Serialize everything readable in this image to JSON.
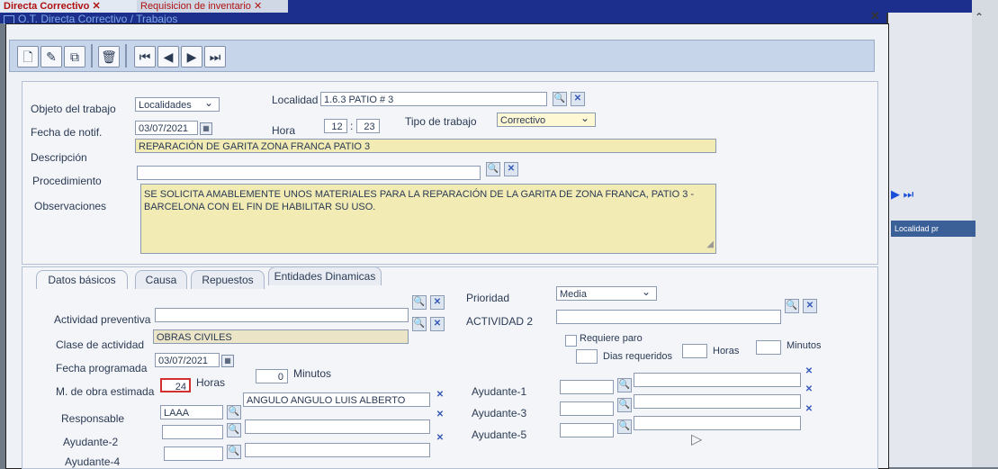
{
  "tabs": [
    {
      "label": "Directa Correctivo",
      "close": "✕"
    },
    {
      "label": "Requisicion de inventario",
      "close": "✕"
    }
  ],
  "breadcrumb": "O.T. Directa Correctivo / Trabajos",
  "toolbar": {
    "new": "🗋",
    "edit": "✎",
    "copy": "⧉",
    "delete": "🗑",
    "first": "⏮",
    "prev": "◀",
    "next": "▶",
    "last": "⏭"
  },
  "form": {
    "objeto_label": "Objeto del trabajo",
    "objeto_value": "Localidades",
    "localidad_label": "Localidad",
    "localidad_value": "1.6.3 PATIO # 3",
    "fecha_label": "Fecha de notif.",
    "fecha_value": "03/07/2021",
    "hora_label": "Hora",
    "hora_h": "12",
    "hora_sep": ":",
    "hora_m": "23",
    "tipo_label": "Tipo de trabajo",
    "tipo_value": "Correctivo",
    "descripcion_label": "Descripción",
    "descripcion_value": "REPARACIÓN DE GARITA ZONA FRANCA PATIO 3",
    "procedimiento_label": "Procedimiento",
    "procedimiento_value": "",
    "observaciones_label": "Observaciones",
    "observaciones_line1": "SE SOLICITA AMABLEMENTE UNOS MATERIALES PARA LA REPARACIÓN DE LA GARITA DE ZONA FRANCA, PATIO 3 -",
    "observaciones_line2": "BARCELONA CON EL FIN DE HABILITAR SU USO."
  },
  "panel_tabs": [
    "Datos básicos",
    "Causa",
    "Repuestos",
    "Entidades Dinamicas"
  ],
  "datos": {
    "actividad_prev_label": "Actividad preventiva",
    "clase_label": "Clase de actividad",
    "clase_value": "OBRAS CIVILES",
    "fecha_prog_label": "Fecha programada",
    "fecha_prog_value": "03/07/2021",
    "mano_obra_label": "M. de obra estimada",
    "mano_obra_horas": "24",
    "horas_label": "Horas",
    "minutos_value": "0",
    "minutos_label": "Minutos",
    "responsable_label": "Responsable",
    "responsable_code": "LAAA",
    "responsable_name": "ANGULO ANGULO LUIS ALBERTO",
    "ayudante2_label": "Ayudante-2",
    "ayudante4_label": "Ayudante-4",
    "prioridad_label": "Prioridad",
    "prioridad_value": "Media",
    "actividad2_label": "ACTIVIDAD 2",
    "requiere_paro_label": "Requiere paro",
    "dias_label": "Dias requeridos",
    "paro_horas_label": "Horas",
    "paro_minutos_label": "Minutos",
    "ayudante1_label": "Ayudante-1",
    "ayudante3_label": "Ayudante-3",
    "ayudante5_label": "Ayudante-5"
  },
  "background_window": {
    "column_header": "Localidad pr"
  }
}
